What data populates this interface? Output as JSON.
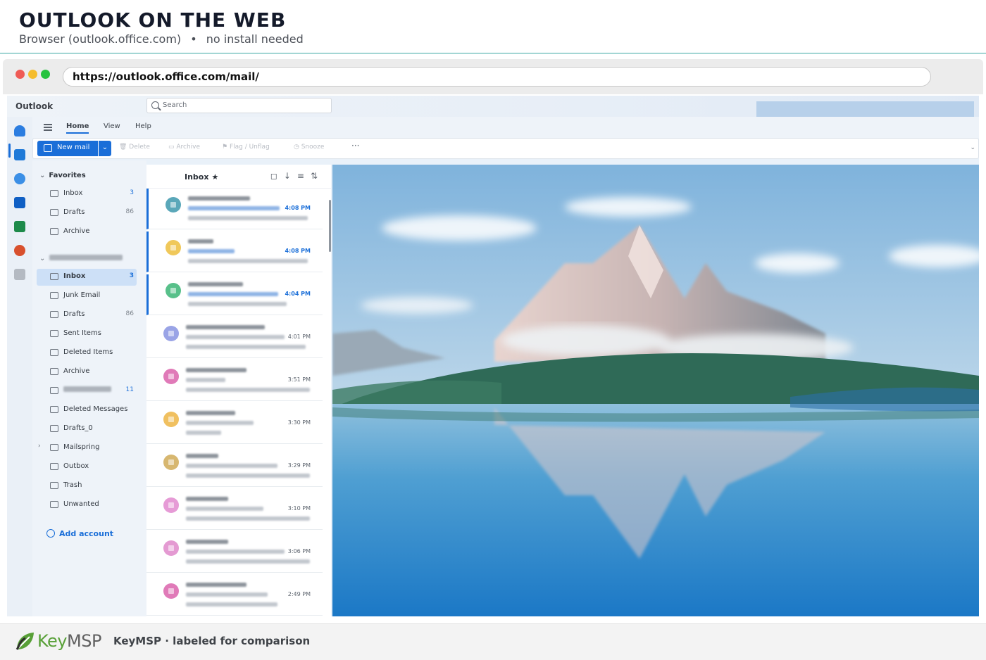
{
  "header": {
    "title": "OUTLOOK ON THE WEB",
    "subtitle_left": "Browser (outlook.office.com)",
    "subtitle_sep": "•",
    "subtitle_right": "no install needed"
  },
  "browser": {
    "url": "https://outlook.office.com/mail/"
  },
  "outlook": {
    "app_name": "Outlook",
    "search_placeholder": "Search",
    "rail_icons": [
      "mail-icon",
      "calendar-icon",
      "people-icon",
      "outlook-icon",
      "excel-icon",
      "powerpoint-icon",
      "apps-icon"
    ],
    "ribbon_tabs": [
      "Home",
      "View",
      "Help"
    ],
    "toolbar": {
      "new_mail": "New mail",
      "delete": "Delete",
      "archive": "Archive",
      "flag": "Flag / Unflag",
      "snooze": "Snooze",
      "more": "···"
    },
    "favorites_label": "Favorites",
    "favorites": [
      {
        "label": "Inbox",
        "count": "3"
      },
      {
        "label": "Drafts",
        "count": "86"
      },
      {
        "label": "Archive",
        "count": ""
      }
    ],
    "folders": [
      {
        "label": "Inbox",
        "count": "3",
        "selected": true
      },
      {
        "label": "Junk Email",
        "count": ""
      },
      {
        "label": "Drafts",
        "count": "86"
      },
      {
        "label": "Sent Items",
        "count": ""
      },
      {
        "label": "Deleted Items",
        "count": ""
      },
      {
        "label": "Archive",
        "count": ""
      },
      {
        "label": "",
        "count": "11"
      },
      {
        "label": "Deleted Messages",
        "count": ""
      },
      {
        "label": "Drafts_0",
        "count": ""
      },
      {
        "label": "Mailspring",
        "count": ""
      },
      {
        "label": "Outbox",
        "count": ""
      },
      {
        "label": "Trash",
        "count": ""
      },
      {
        "label": "Unwanted",
        "count": ""
      }
    ],
    "add_account": "Add account",
    "list_title": "Inbox",
    "messages": [
      {
        "time": "4:08 PM",
        "unread": true,
        "avatar": "#5aa7b9"
      },
      {
        "time": "4:08 PM",
        "unread": true,
        "avatar": "#f0c85a"
      },
      {
        "time": "4:04 PM",
        "unread": true,
        "avatar": "#58c08a"
      },
      {
        "time": "4:01 PM",
        "unread": false,
        "avatar": "#9aa4e6"
      },
      {
        "time": "3:51 PM",
        "unread": false,
        "avatar": "#e07ab8"
      },
      {
        "time": "3:30 PM",
        "unread": false,
        "avatar": "#f0c060"
      },
      {
        "time": "3:29 PM",
        "unread": false,
        "avatar": "#d7b770"
      },
      {
        "time": "3:10 PM",
        "unread": false,
        "avatar": "#e69bd6"
      },
      {
        "time": "3:06 PM",
        "unread": false,
        "avatar": "#e49ad2"
      },
      {
        "time": "2:49 PM",
        "unread": false,
        "avatar": "#e07ab8"
      }
    ]
  },
  "footer": {
    "logo_key": "Key",
    "logo_msp": "MSP",
    "caption": "KeyMSP · labeled for comparison"
  },
  "colors": {
    "accent": "#1a6ed8",
    "header_rule": "#3aa7a3",
    "brand_green": "#58a037"
  }
}
